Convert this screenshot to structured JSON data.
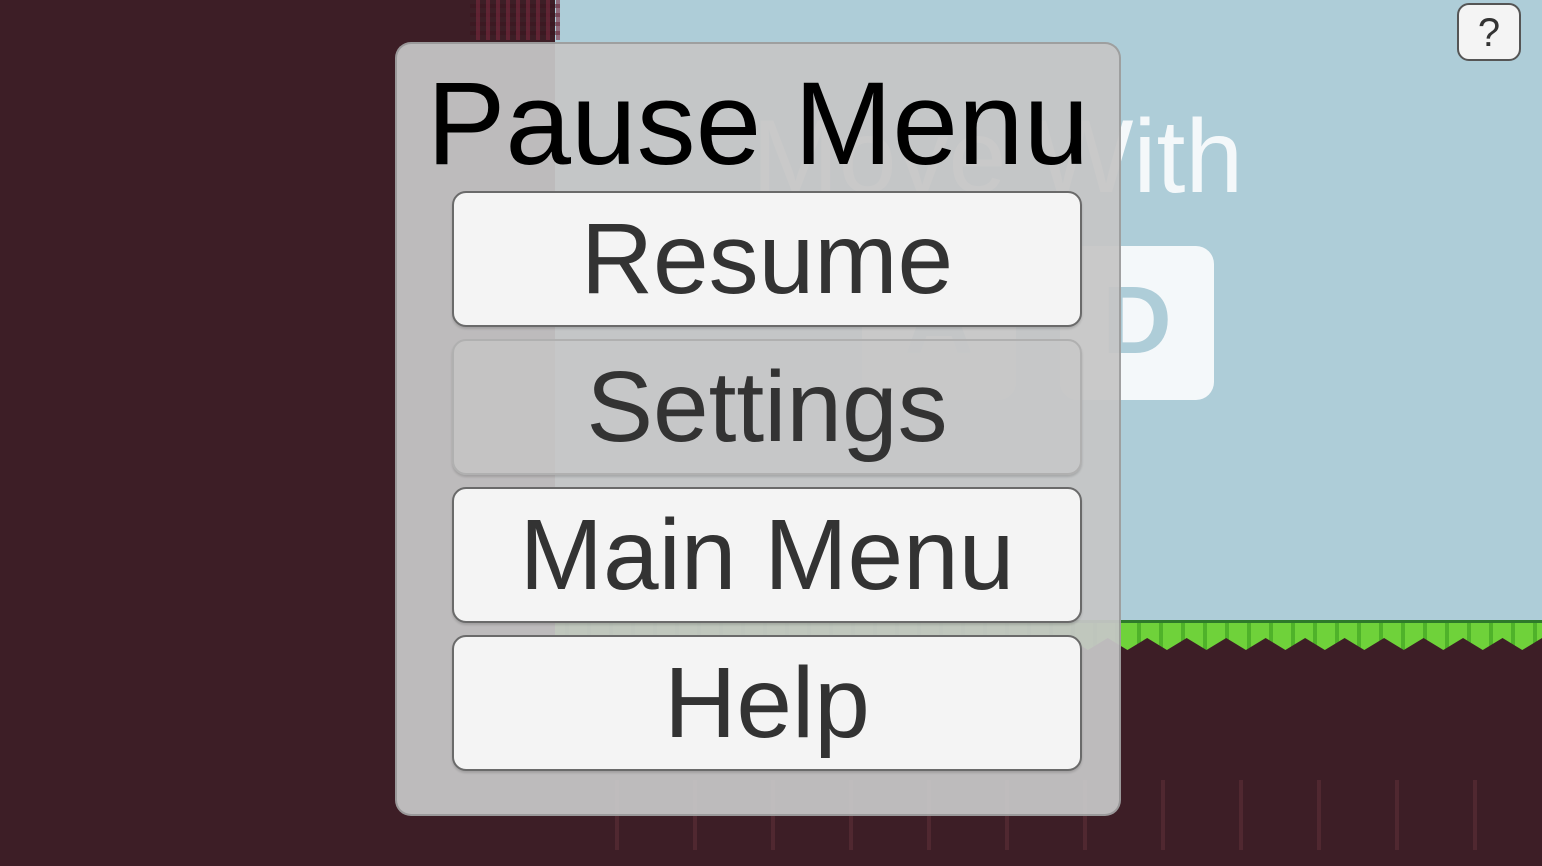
{
  "background": {
    "hint_text": "Move With",
    "keys": [
      "A",
      "D"
    ]
  },
  "corner_help": {
    "label": "?"
  },
  "pause_menu": {
    "title": "Pause Menu",
    "buttons": [
      {
        "label": "Resume"
      },
      {
        "label": "Settings"
      },
      {
        "label": "Main Menu"
      },
      {
        "label": "Help"
      }
    ]
  },
  "colors": {
    "sky": "#aecdd8",
    "dirt": "#3d1e26",
    "grass": "#6fd23a",
    "panel": "#c6c6c6",
    "button": "#f4f4f4"
  }
}
